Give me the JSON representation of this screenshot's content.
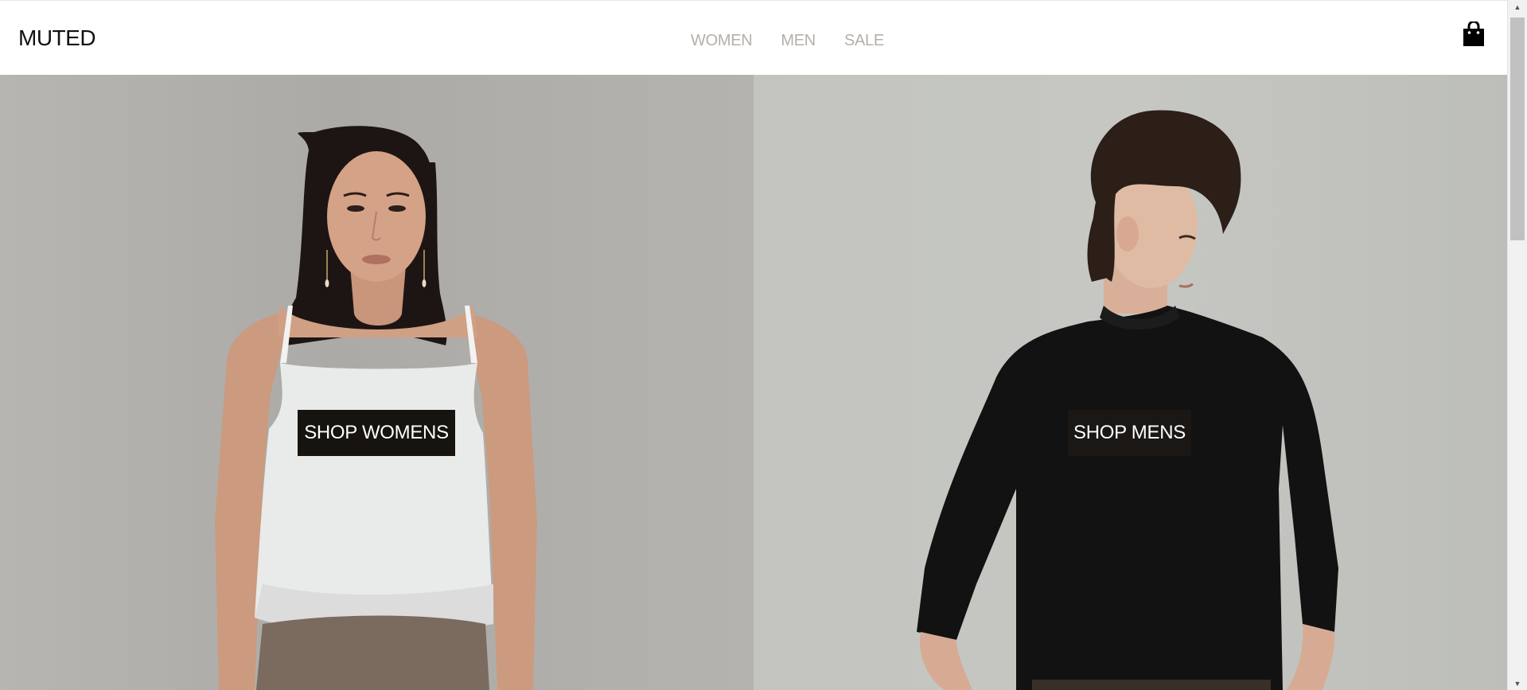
{
  "header": {
    "logo": "MUTED",
    "nav": [
      {
        "label": "WOMEN"
      },
      {
        "label": "MEN"
      },
      {
        "label": "SALE"
      }
    ],
    "cart_icon": "shopping-bag-icon"
  },
  "hero": {
    "women": {
      "button_label": "SHOP WOMENS",
      "image": "woman-in-white-camisole-photo"
    },
    "men": {
      "button_label": "SHOP MENS",
      "image": "man-in-black-long-sleeve-photo"
    }
  },
  "colors": {
    "nav_text": "#b5afaa",
    "button_bg": "#17140f",
    "button_text": "#ffffff",
    "logo_text": "#111111"
  }
}
